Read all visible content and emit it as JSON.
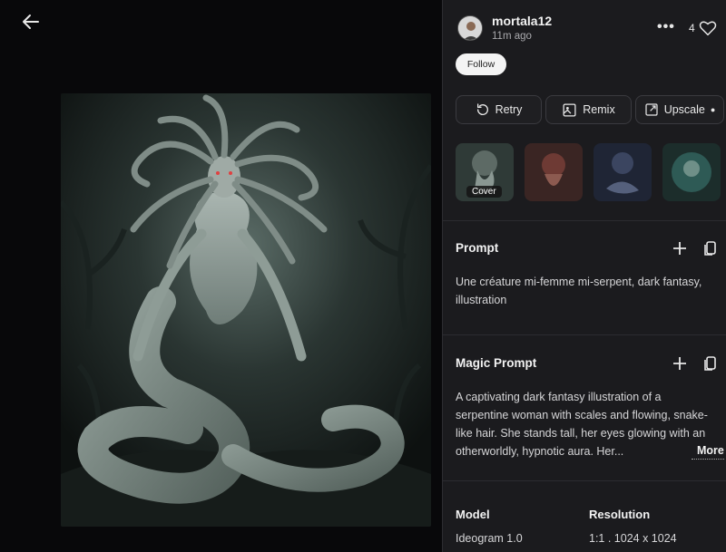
{
  "nav": {
    "back_icon": "arrow-left-icon"
  },
  "author": {
    "username": "mortala12",
    "time_ago": "11m ago",
    "follow_label": "Follow",
    "likes": "4"
  },
  "actions": {
    "retry_label": "Retry",
    "remix_label": "Remix",
    "upscale_label": "Upscale"
  },
  "thumbnails": [
    {
      "name": "variant-1",
      "cover_label": "Cover"
    },
    {
      "name": "variant-2"
    },
    {
      "name": "variant-3"
    },
    {
      "name": "variant-4"
    }
  ],
  "prompt": {
    "title": "Prompt",
    "text": "Une créature mi-femme mi-serpent, dark fantasy, illustration"
  },
  "magic_prompt": {
    "title": "Magic Prompt",
    "text": "A captivating dark fantasy illustration of a serpentine woman with scales and flowing, snake-like hair. She stands tall, her eyes glowing with an otherworldly, hypnotic aura. Her...",
    "more_label": "More"
  },
  "meta": {
    "model_label": "Model",
    "model_value": "Ideogram 1.0",
    "resolution_label": "Resolution",
    "resolution_value": "1:1 . 1024 x 1024"
  },
  "colors": {
    "panel_bg": "#1b1b1e",
    "stage_bg": "#08080a",
    "border": "#2c2c30",
    "follow_bg": "#f4f4f4"
  }
}
